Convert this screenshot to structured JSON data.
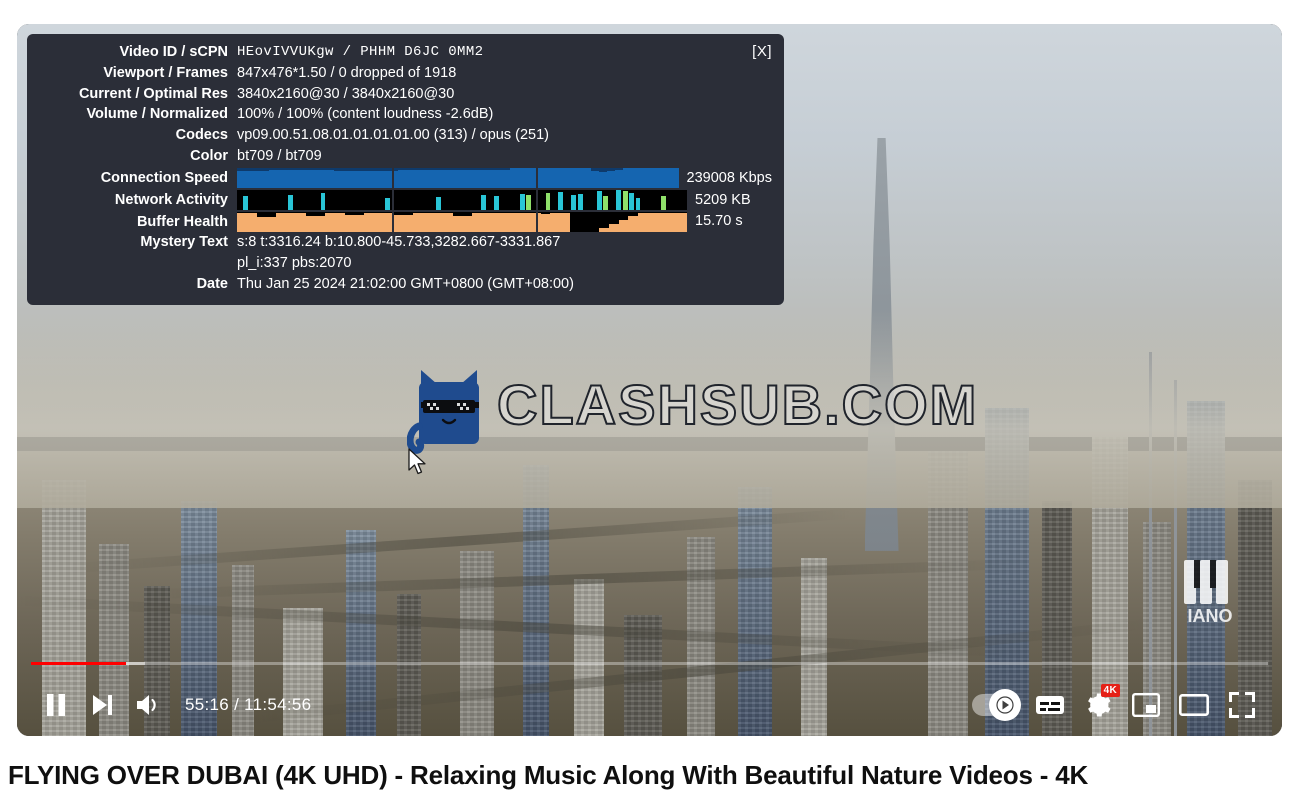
{
  "stats_panel": {
    "close_label": "[X]",
    "rows": [
      {
        "label": "Video ID / sCPN",
        "value": "HEovIVVUKgw / PHHM D6JC 0MM2",
        "mono": true
      },
      {
        "label": "Viewport / Frames",
        "value": "847x476*1.50 / 0 dropped of 1918"
      },
      {
        "label": "Current / Optimal Res",
        "value": "3840x2160@30 / 3840x2160@30"
      },
      {
        "label": "Volume / Normalized",
        "value": "100% / 100% (content loudness -2.6dB)"
      },
      {
        "label": "Codecs",
        "value": "vp09.00.51.08.01.01.01.01.00 (313) / opus (251)"
      },
      {
        "label": "Color",
        "value": "bt709 / bt709"
      }
    ],
    "graphs": [
      {
        "label": "Connection Speed",
        "value": "239008 Kbps",
        "color": "#1565b0"
      },
      {
        "label": "Network Activity",
        "value": "5209 KB",
        "color": "#29c5d6"
      },
      {
        "label": "Buffer Health",
        "value": "15.70 s",
        "color": "#f5ae6e"
      }
    ],
    "mystery": {
      "label": "Mystery Text",
      "line1": "s:8 t:3316.24 b:10.800-45.733,3282.667-3331.867",
      "line2": "pl_i:337 pbs:2070"
    },
    "date": {
      "label": "Date",
      "value": "Thu Jan 25 2024 21:02:00 GMT+0800 (GMT+08:00)"
    }
  },
  "watermark": {
    "text": "CLASHSUB.COM",
    "mascot": "cat-with-sunglasses-icon"
  },
  "channel_watermark": {
    "text": "IANO"
  },
  "player": {
    "progress_percent": 7.7,
    "time_display": "55:16 / 11:54:56",
    "current_time": "55:16",
    "duration": "11:54:56",
    "accent_color": "#ff0000",
    "controls_left": [
      {
        "name": "pause-button",
        "icon": "pause-icon",
        "label": "Pause"
      },
      {
        "name": "next-button",
        "icon": "next-track-icon",
        "label": "Next"
      },
      {
        "name": "volume-button",
        "icon": "volume-on-icon",
        "label": "Mute"
      }
    ],
    "controls_right": [
      {
        "name": "autoplay-toggle",
        "icon": "autoplay-toggle-icon",
        "label": "Autoplay",
        "state": "on"
      },
      {
        "name": "subtitles-button",
        "icon": "subtitles-cc-icon",
        "label": "Subtitles/CC"
      },
      {
        "name": "settings-button",
        "icon": "gear-icon",
        "label": "Settings",
        "badge": "4K"
      },
      {
        "name": "miniplayer-button",
        "icon": "miniplayer-icon",
        "label": "Miniplayer"
      },
      {
        "name": "theater-button",
        "icon": "theater-mode-icon",
        "label": "Theater mode"
      },
      {
        "name": "fullscreen-button",
        "icon": "fullscreen-icon",
        "label": "Full screen"
      }
    ]
  },
  "video": {
    "title": "FLYING OVER DUBAI (4K UHD) - Relaxing Music Along With Beautiful Nature Videos - 4K"
  },
  "chart_data": [
    {
      "type": "area",
      "title": "Connection Speed",
      "ylabel": "Kbps",
      "current_value": "239008 Kbps",
      "values": [
        88,
        88,
        88,
        88,
        92,
        92,
        92,
        92,
        92,
        92,
        92,
        92,
        88,
        88,
        88,
        88,
        88,
        88,
        88,
        88,
        92,
        92,
        92,
        92,
        92,
        92,
        92,
        92,
        92,
        92,
        92,
        92,
        92,
        92,
        100,
        100,
        100,
        100,
        100,
        100,
        100,
        100,
        100,
        100,
        88,
        82,
        88,
        92,
        100,
        100,
        100,
        100,
        100,
        100,
        100,
        100
      ],
      "fill_color": "#1565b0",
      "bg_color": "#0e3a6b"
    },
    {
      "type": "bar",
      "title": "Network Activity",
      "ylabel": "KB",
      "current_value": "5209 KB",
      "values": [
        0,
        70,
        0,
        0,
        0,
        0,
        0,
        0,
        75,
        0,
        0,
        0,
        0,
        85,
        0,
        0,
        0,
        0,
        0,
        0,
        0,
        0,
        0,
        60,
        0,
        0,
        0,
        0,
        0,
        0,
        0,
        65,
        0,
        0,
        0,
        0,
        0,
        0,
        75,
        0,
        70,
        0,
        0,
        0,
        80,
        75,
        0,
        0,
        85,
        0,
        90,
        0,
        75,
        80,
        0,
        0,
        95,
        70,
        0,
        100,
        95,
        85,
        60,
        0,
        0,
        0,
        70,
        0,
        0,
        0
      ],
      "fill_color": "#29c5d6",
      "bg_color": "#000000"
    },
    {
      "type": "area",
      "title": "Buffer Health",
      "ylabel": "s",
      "current_value": "15.70 s",
      "values": [
        95,
        95,
        75,
        75,
        95,
        95,
        95,
        80,
        80,
        95,
        95,
        85,
        85,
        95,
        95,
        95,
        85,
        85,
        95,
        95,
        95,
        95,
        80,
        80,
        95,
        95,
        95,
        95,
        95,
        95,
        95,
        90,
        95,
        95,
        0,
        0,
        0,
        20,
        40,
        60,
        80,
        95,
        95,
        95,
        95,
        95
      ],
      "fill_color": "#f5ae6e",
      "bg_color": "#000000"
    }
  ]
}
